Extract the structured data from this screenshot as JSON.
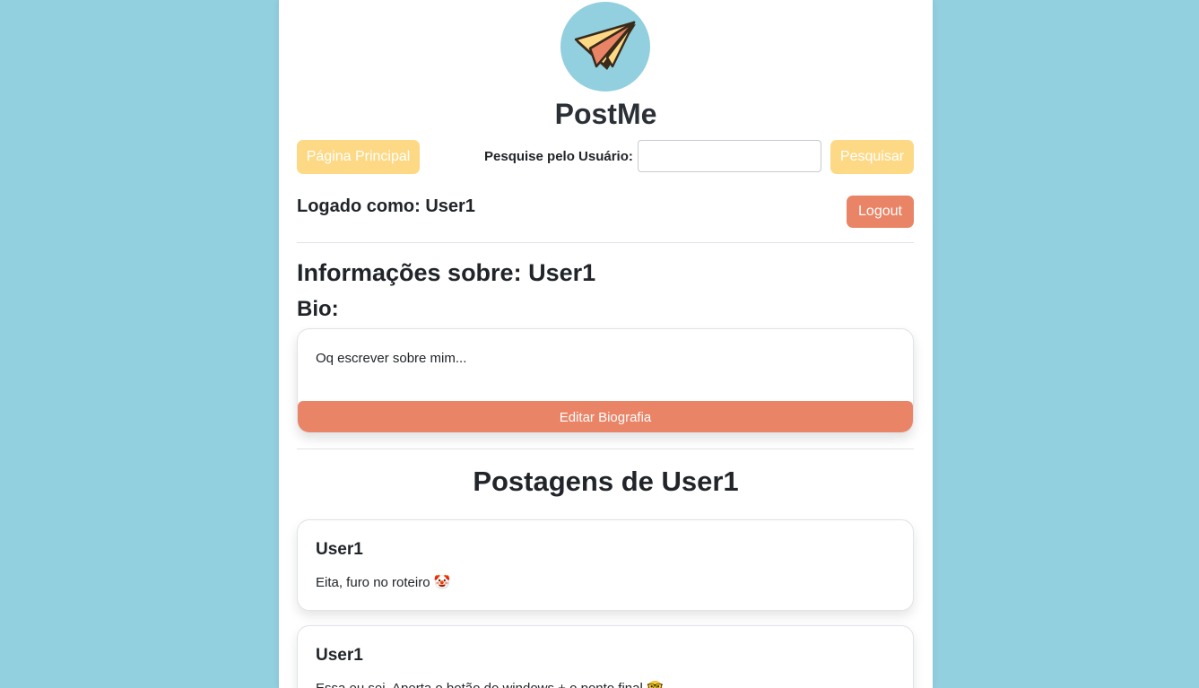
{
  "app": {
    "title": "PostMe",
    "logo_icon": "paper-plane-icon",
    "colors": {
      "background": "#92cfdf",
      "accent_yellow": "#fdd986",
      "accent_orange": "#ea8466"
    }
  },
  "nav": {
    "home_label": "Página Principal",
    "search_label": "Pesquise pelo Usuário:",
    "search_value": "",
    "search_button_label": "Pesquisar"
  },
  "session": {
    "logged_as": "Logado como: User1",
    "logout_label": "Logout"
  },
  "profile": {
    "info_prefix": "Informações sobre: ",
    "username": "User1",
    "bio_label": "Bio:",
    "bio_text": "Oq escrever sobre mim...",
    "edit_bio_label": "Editar Biografia"
  },
  "posts": {
    "heading": "Postagens de User1",
    "items": [
      {
        "author": "User1",
        "body": "Eita, furo no roteiro 🤡"
      },
      {
        "author": "User1",
        "body": "Essa eu sei, Aperta o botão do windows + o ponto final 🤓"
      }
    ]
  }
}
